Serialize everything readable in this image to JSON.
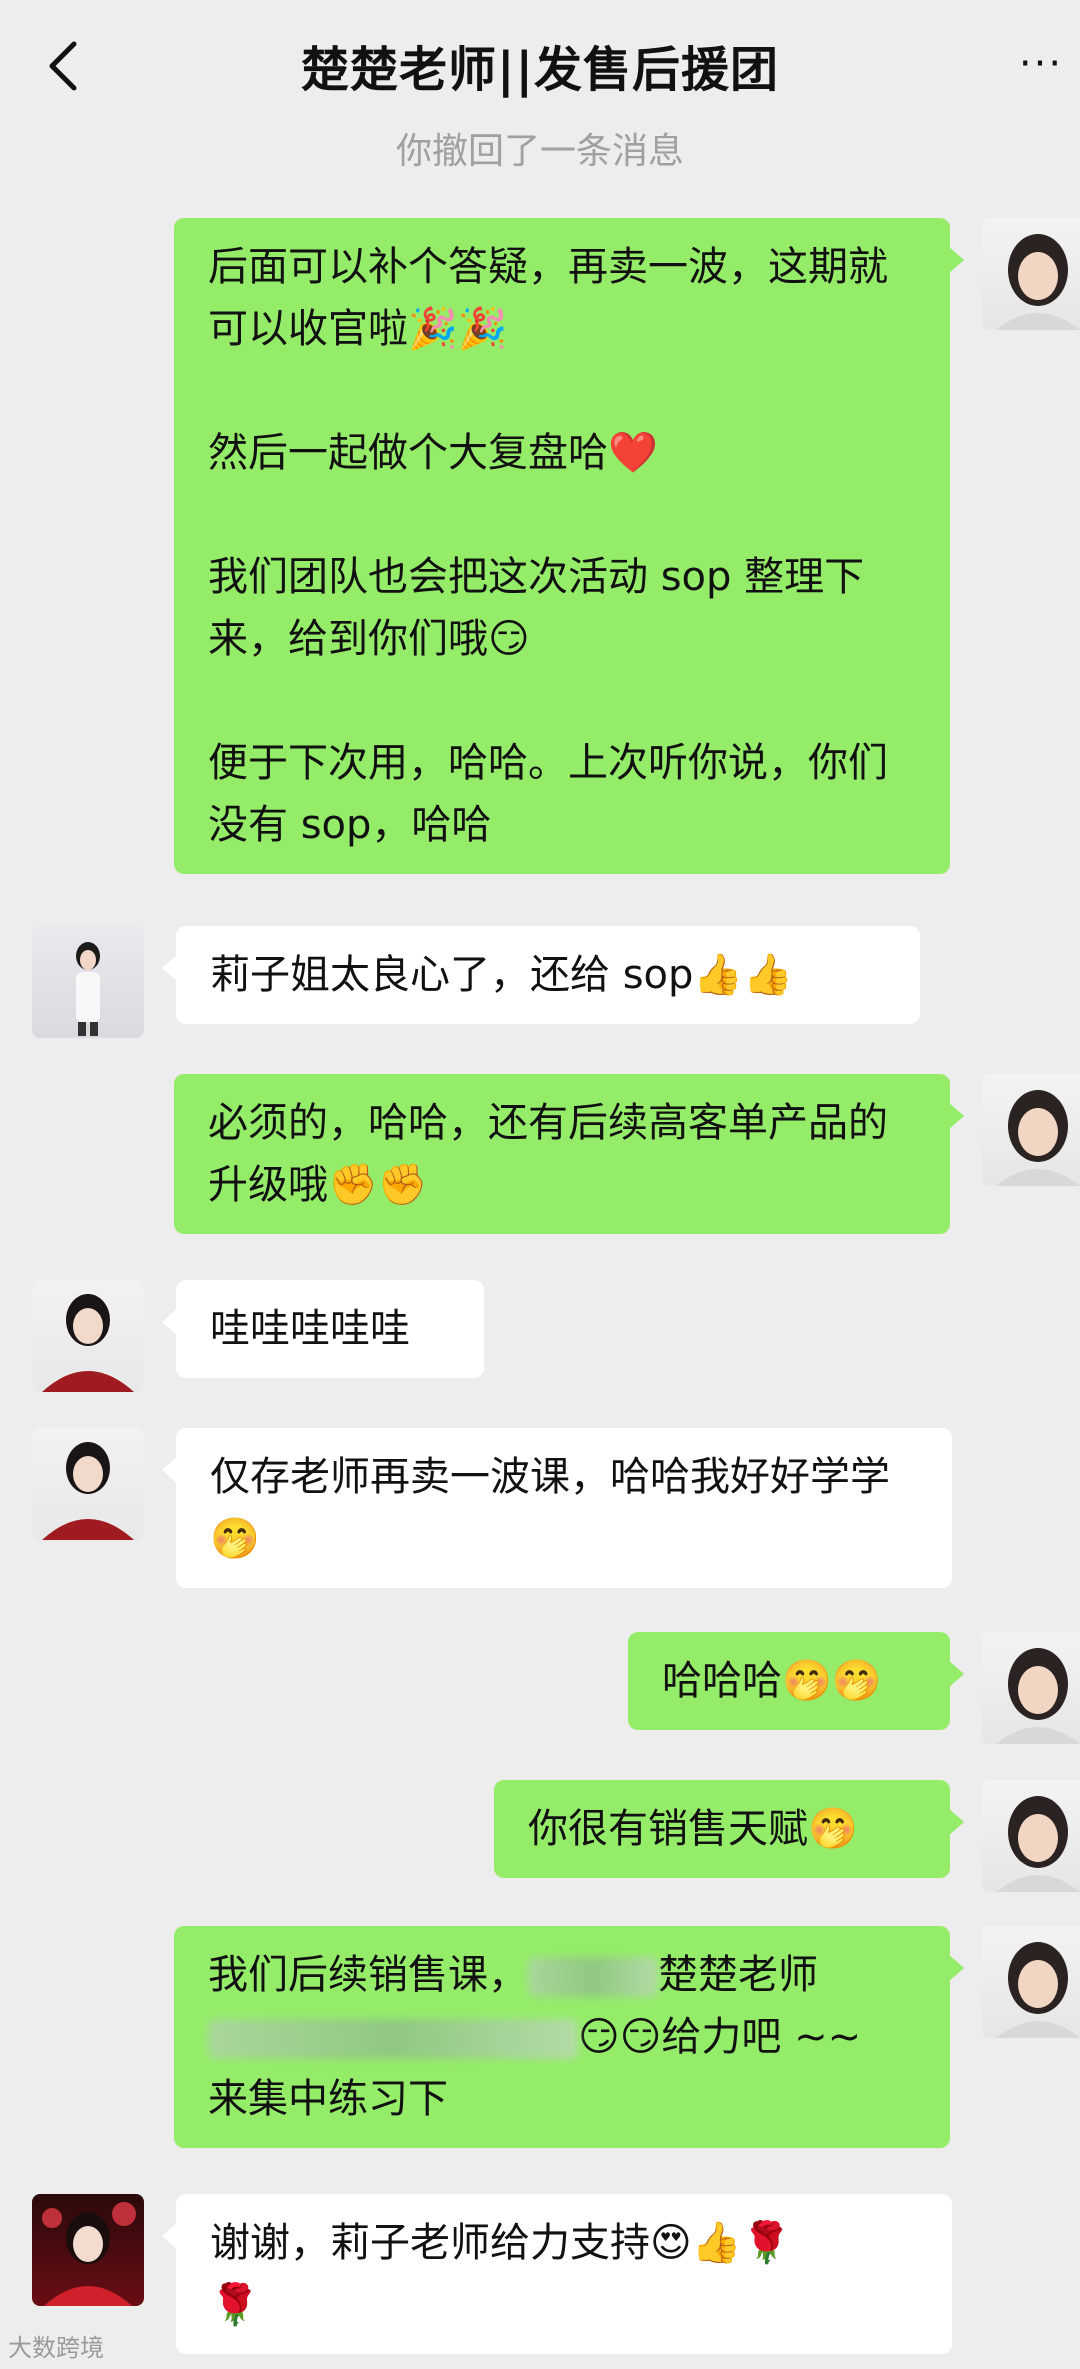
{
  "header": {
    "title": "楚楚老师||发售后援团",
    "back_icon": "chevron-left-icon",
    "more_icon": "more-dots-icon",
    "more_label": "···"
  },
  "system_notice": "你撤回了一条消息",
  "messages": [
    {
      "sender": "self",
      "text": "后面可以补个答疑，再卖一波，这期就可以收官啦🎉🎉\n\n然后一起做个大复盘哈❤️\n\n我们团队也会把这次活动 sop 整理下来，给到你们哦😏\n\n便于下次用，哈哈。上次听你说，你们没有 sop，哈哈"
    },
    {
      "sender": "other",
      "text": "莉子姐太良心了，还给 sop👍👍"
    },
    {
      "sender": "self",
      "text": "必须的，哈哈，还有后续高客单产品的升级哦✊✊"
    },
    {
      "sender": "other",
      "text": "哇哇哇哇哇"
    },
    {
      "sender": "other",
      "text": "仅存老师再卖一波课，哈哈我好好学学🤭"
    },
    {
      "sender": "self",
      "text": "哈哈哈🤭🤭"
    },
    {
      "sender": "self",
      "text": "你很有销售天赋🤭"
    },
    {
      "sender": "self",
      "text_a": "我们后续销售课，",
      "text_b": "楚楚老师",
      "text_c": "😏😏给力吧 ~~",
      "text_d": "来集中练习下"
    },
    {
      "sender": "other",
      "text": "谢谢，莉子老师给力支持😍👍🌹\n🌹"
    }
  ],
  "watermark": "大数跨境",
  "colors": {
    "self_bubble": "#95ec69",
    "other_bubble": "#ffffff",
    "background": "#ededed"
  }
}
